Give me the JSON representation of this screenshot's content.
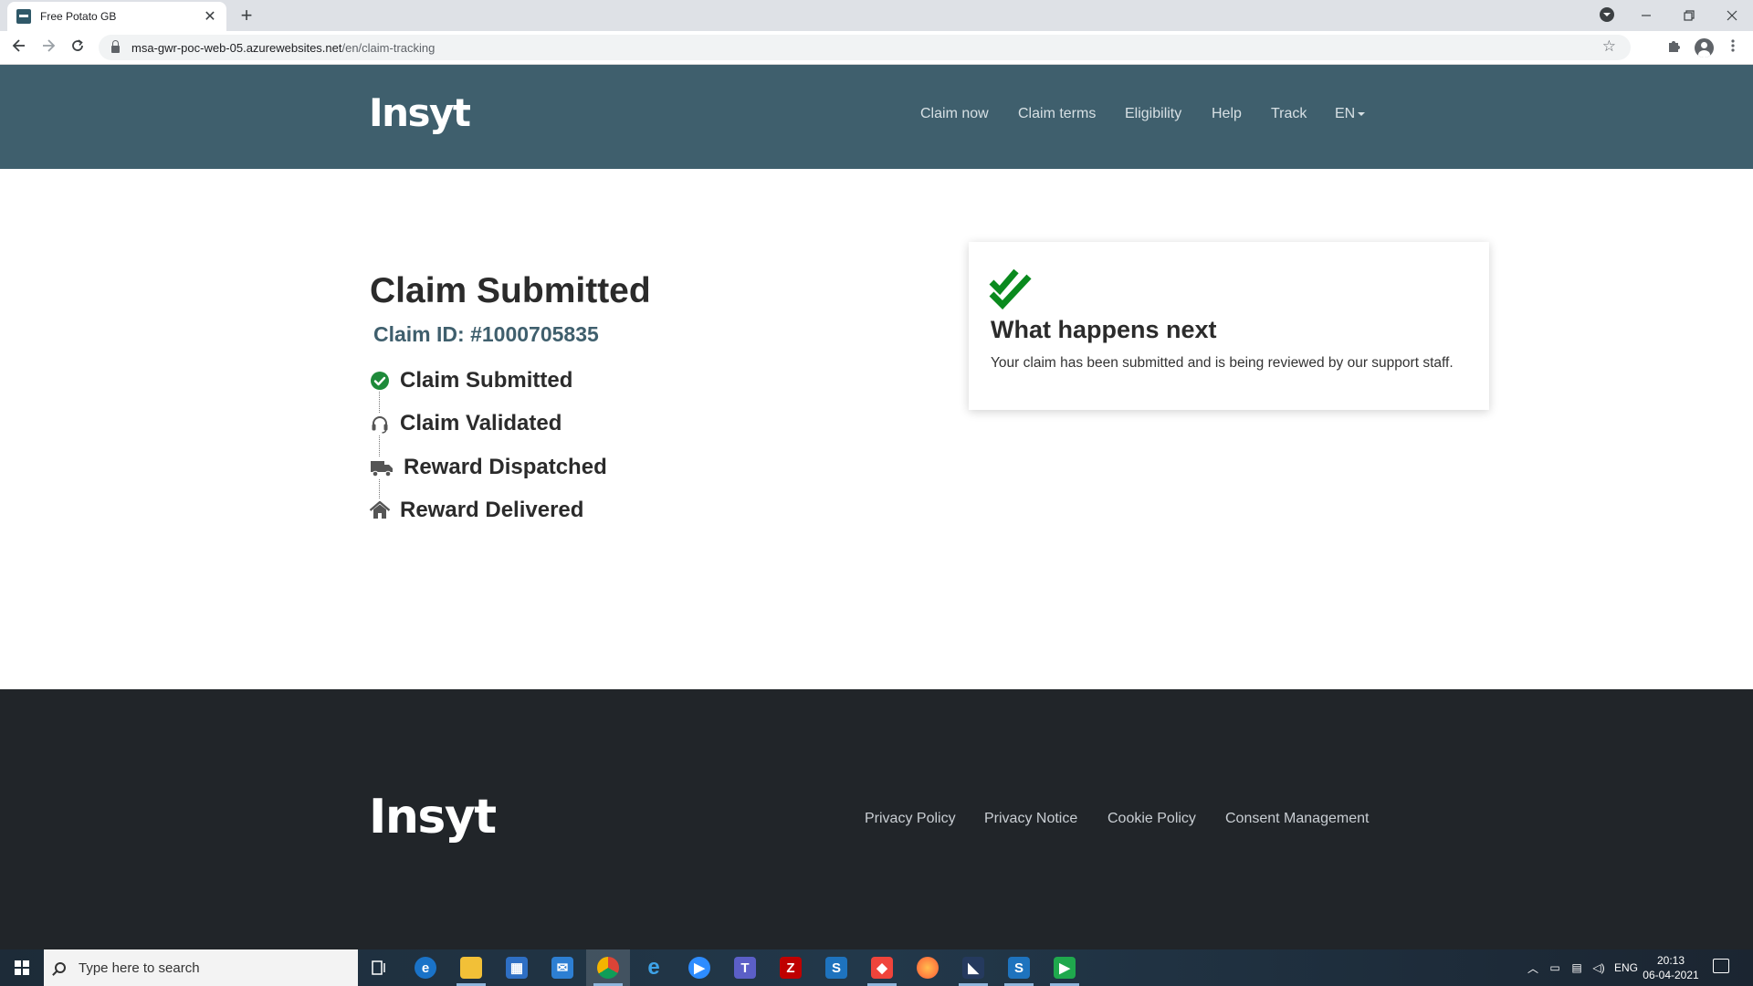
{
  "browser": {
    "tab_title": "Free Potato GB",
    "tab_close": "✕",
    "new_tab": "+",
    "url_host": "msa-gwr-poc-web-05.azurewebsites.net",
    "url_path": "/en/claim-tracking"
  },
  "header": {
    "logo": "Insyt",
    "nav": {
      "claim_now": "Claim now",
      "claim_terms": "Claim terms",
      "eligibility": "Eligibility",
      "help": "Help",
      "track": "Track",
      "language": "EN"
    }
  },
  "main": {
    "title": "Claim Submitted",
    "claim_id": "Claim ID: #1000705835",
    "steps": [
      {
        "label": "Claim Submitted",
        "icon": "check-circle-icon",
        "status": "done",
        "color": "#1e8a3a"
      },
      {
        "label": "Claim Validated",
        "icon": "headset-icon",
        "status": "pending"
      },
      {
        "label": "Reward Dispatched",
        "icon": "truck-icon",
        "status": "pending"
      },
      {
        "label": "Reward Delivered",
        "icon": "home-icon",
        "status": "pending"
      }
    ],
    "card": {
      "icon": "double-check-icon",
      "title": "What happens next",
      "text": "Your claim has been submitted and is being reviewed by our support staff."
    }
  },
  "footer": {
    "logo": "Insyt",
    "links": {
      "privacy_policy": "Privacy Policy",
      "privacy_notice": "Privacy Notice",
      "cookie_policy": "Cookie Policy",
      "consent": "Consent Management"
    }
  },
  "taskbar": {
    "search_placeholder": "Type here to search",
    "language": "ENG",
    "time": "20:13",
    "date": "06-04-2021"
  },
  "colors": {
    "header_bg": "#3f5f6d",
    "footer_bg": "#212529",
    "accent_green": "#0a8a1e",
    "claim_id": "#3f5f6d"
  }
}
